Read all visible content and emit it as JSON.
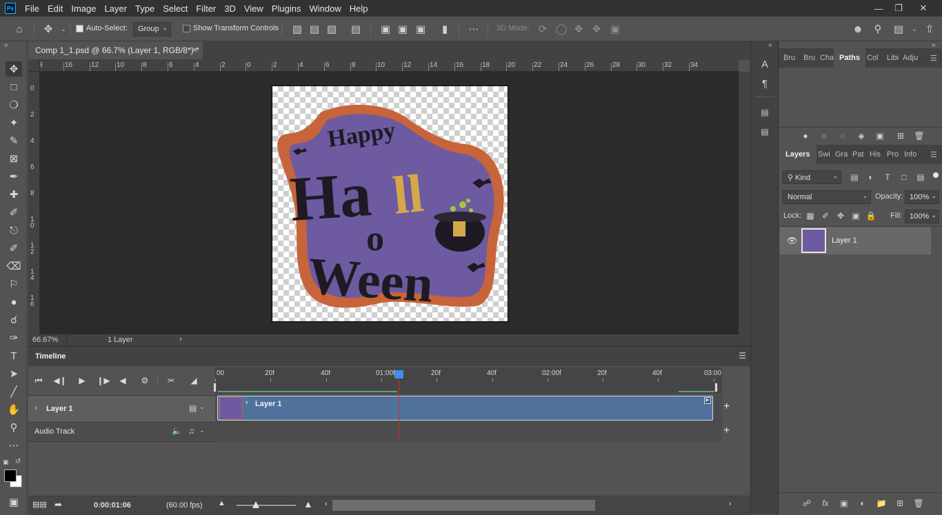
{
  "app": {
    "logo": "Ps",
    "menu": [
      "File",
      "Edit",
      "Image",
      "Layer",
      "Type",
      "Select",
      "Filter",
      "3D",
      "View",
      "Plugins",
      "Window",
      "Help"
    ]
  },
  "options": {
    "auto_select_label": "Auto-Select:",
    "auto_select_value": "Group",
    "show_transform_label": "Show Transform Controls",
    "mode_3d_label": "3D Mode:"
  },
  "document": {
    "tab_title": "Comp 1_1.psd @ 66.7% (Layer 1, RGB/8*) *",
    "zoom": "66.67%",
    "layers_count": "1 Layer",
    "ruler_h": [
      "8",
      "16",
      "12",
      "10",
      "8",
      "6",
      "4",
      "2",
      "0",
      "2",
      "4",
      "6",
      "8",
      "10",
      "12",
      "14",
      "16",
      "18",
      "20",
      "22",
      "24",
      "26",
      "28",
      "30",
      "32",
      "34"
    ],
    "ruler_v": [
      "0",
      "2",
      "4",
      "6",
      "8",
      "1 0",
      "1 2",
      "1 4",
      "1 6"
    ],
    "artwork": {
      "word1": "Happy",
      "word2_top": "Ha",
      "word2_mid": "ll",
      "word3": "o",
      "word4": "Ween",
      "accent_purple": "#6e5aa0",
      "accent_orange": "#c86439",
      "accent_gold": "#d4a84a"
    }
  },
  "timeline": {
    "title": "Timeline",
    "ruler_labels": [
      "00",
      "20f",
      "40f",
      "01:00f",
      "20f",
      "40f",
      "02:00f",
      "20f",
      "40f",
      "03:00"
    ],
    "tracks": [
      {
        "name": "Layer 1"
      },
      {
        "name": "Audio Track"
      }
    ],
    "clip_label": "Layer 1",
    "current_time": "0:00:01:06",
    "fps": "(60.00 fps)"
  },
  "panels": {
    "top_tabs": [
      "Bru",
      "Bru",
      "Cha",
      "Paths",
      "Col",
      "Libi",
      "Adju"
    ],
    "layers_tabs": [
      "Layers",
      "Swi",
      "Gra",
      "Pat",
      "His",
      "Pro",
      "Info"
    ],
    "kind_filter": "Kind",
    "blend_mode": "Normal",
    "opacity_label": "Opacity:",
    "opacity_value": "100%",
    "lock_label": "Lock:",
    "fill_label": "Fill:",
    "fill_value": "100%",
    "layer_name": "Layer 1"
  }
}
